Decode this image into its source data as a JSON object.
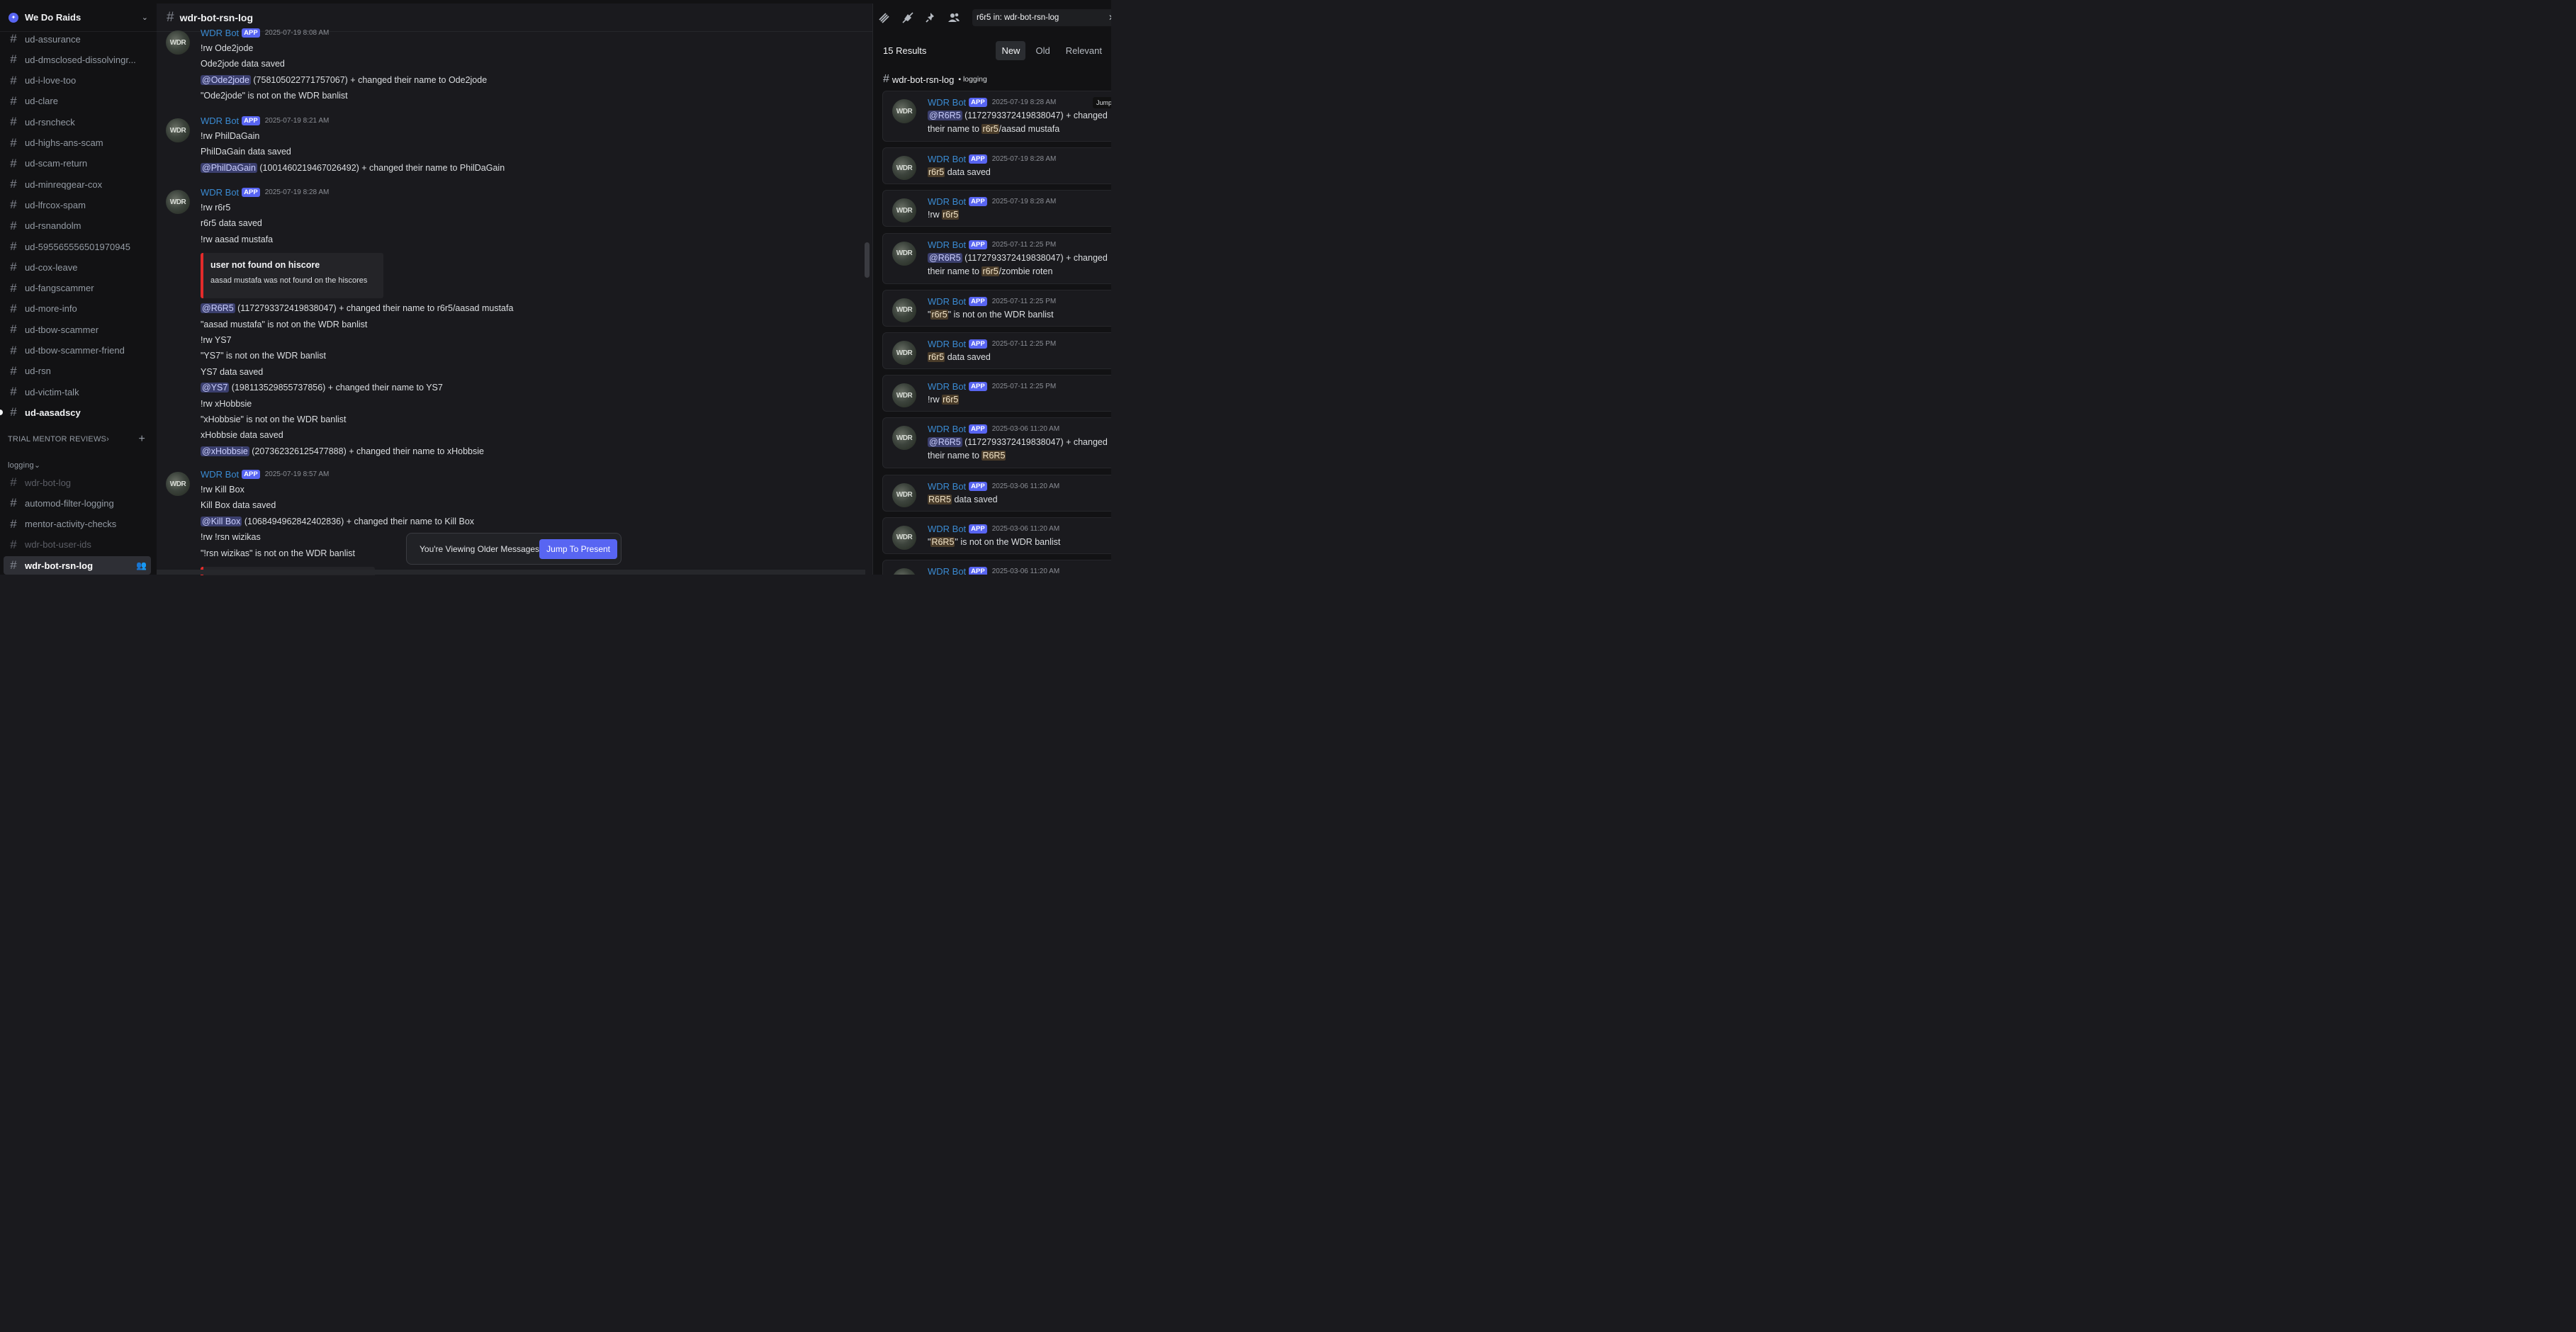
{
  "server": {
    "name": "We Do Raids"
  },
  "sidebar": {
    "channels_top": [
      {
        "name": "ud-assurance",
        "state": "normal"
      },
      {
        "name": "ud-dmsclosed-dissolvingr...",
        "state": "normal"
      },
      {
        "name": "ud-i-love-too",
        "state": "normal"
      },
      {
        "name": "ud-clare",
        "state": "normal"
      },
      {
        "name": "ud-rsncheck",
        "state": "normal"
      },
      {
        "name": "ud-highs-ans-scam",
        "state": "normal"
      },
      {
        "name": "ud-scam-return",
        "state": "normal"
      },
      {
        "name": "ud-minreqgear-cox",
        "state": "normal"
      },
      {
        "name": "ud-lfrcox-spam",
        "state": "normal"
      },
      {
        "name": "ud-rsnandolm",
        "state": "normal"
      },
      {
        "name": "ud-595565556501970945",
        "state": "normal"
      },
      {
        "name": "ud-cox-leave",
        "state": "normal"
      },
      {
        "name": "ud-fangscammer",
        "state": "normal"
      },
      {
        "name": "ud-more-info",
        "state": "normal"
      },
      {
        "name": "ud-tbow-scammer",
        "state": "normal"
      },
      {
        "name": "ud-tbow-scammer-friend",
        "state": "normal"
      },
      {
        "name": "ud-rsn",
        "state": "normal"
      },
      {
        "name": "ud-victim-talk",
        "state": "normal"
      },
      {
        "name": "ud-aasadscy",
        "state": "unread"
      }
    ],
    "category_trial": "TRIAL MENTOR REVIEWS",
    "category_logging": "logging",
    "channels_logging": [
      {
        "name": "wdr-bot-log",
        "state": "muted"
      },
      {
        "name": "automod-filter-logging",
        "state": "normal"
      },
      {
        "name": "mentor-activity-checks",
        "state": "normal"
      },
      {
        "name": "wdr-bot-user-ids",
        "state": "muted"
      },
      {
        "name": "wdr-bot-rsn-log",
        "state": "active"
      }
    ]
  },
  "channel": {
    "title": "wdr-bot-rsn-log"
  },
  "messages": [
    {
      "author": "WDR Bot",
      "badge": "APP",
      "time": "2025-07-19 8:08 AM",
      "lines": [
        {
          "text": "!rw Ode2jode"
        },
        {
          "text": "Ode2jode data saved"
        },
        {
          "mention": "@Ode2jode",
          "text": " (758105022771757067) + changed their name to Ode2jode"
        },
        {
          "text": "\"Ode2jode\" is not on the WDR banlist"
        }
      ]
    },
    {
      "author": "WDR Bot",
      "badge": "APP",
      "time": "2025-07-19 8:21 AM",
      "lines": [
        {
          "text": "!rw PhilDaGain"
        },
        {
          "text": "PhilDaGain data saved"
        },
        {
          "mention": "@PhilDaGain",
          "text": " (1001460219467026492) + changed their name to PhilDaGain"
        }
      ]
    },
    {
      "author": "WDR Bot",
      "badge": "APP",
      "time": "2025-07-19 8:28 AM",
      "lines_before": [
        {
          "text": "!rw r6r5"
        },
        {
          "text": "r6r5 data saved"
        },
        {
          "text": "!rw aasad mustafa"
        }
      ],
      "embed": {
        "title": "user not found on hiscore",
        "desc": "aasad mustafa was not found on the hiscores"
      },
      "lines_after": [
        {
          "mention": "@R6R5",
          "text": " (1172793372419838047) + changed their name to r6r5/aasad mustafa"
        },
        {
          "text": "\"aasad mustafa\" is not on the WDR banlist"
        },
        {
          "text": "!rw YS7"
        },
        {
          "text": "\"YS7\" is not on the WDR banlist"
        },
        {
          "text": "YS7 data saved"
        },
        {
          "mention": "@YS7",
          "text": " (198113529855737856) + changed their name to YS7"
        },
        {
          "text": "!rw xHobbsie"
        },
        {
          "text": "\"xHobbsie\" is not on the WDR banlist"
        },
        {
          "text": "xHobbsie data saved"
        },
        {
          "mention": "@xHobbsie",
          "text": " (207362326125477888) + changed their name to xHobbsie"
        }
      ]
    },
    {
      "author": "WDR Bot",
      "badge": "APP",
      "time": "2025-07-19 8:57 AM",
      "lines": [
        {
          "text": "!rw Kill Box"
        },
        {
          "text": "Kill Box data saved"
        },
        {
          "mention": "@Kill Box",
          "text": " (1068494962842402836) + changed their name to Kill Box"
        },
        {
          "text": "!rw !rsn wizikas"
        },
        {
          "text": "\"!rsn wizikas\" is not on the WDR banlist"
        }
      ]
    }
  ],
  "older_bar": {
    "text": "You're Viewing Older Messages",
    "button": "Jump To Present"
  },
  "search": {
    "query": "r6r5  in: wdr-bot-rsn-log",
    "count": "15 Results",
    "tabs": [
      "New",
      "Old",
      "Relevant"
    ],
    "group_channel": "wdr-bot-rsn-log",
    "group_category": "logging",
    "jump_label": "Jump",
    "results": [
      {
        "time": "2025-07-19 8:28 AM",
        "l1": [
          {
            "m": "@R6R5"
          },
          {
            "t": " (1172793372419838047) + changed"
          }
        ],
        "l2": [
          {
            "t": "their name to "
          },
          {
            "h": "r6r5"
          },
          {
            "t": "/aasad mustafa"
          }
        ]
      },
      {
        "time": "2025-07-19 8:28 AM",
        "l1": [
          {
            "h": "r6r5"
          },
          {
            "t": " data saved"
          }
        ]
      },
      {
        "time": "2025-07-19 8:28 AM",
        "l1": [
          {
            "t": "!rw "
          },
          {
            "h": "r6r5"
          }
        ]
      },
      {
        "time": "2025-07-11 2:25 PM",
        "l1": [
          {
            "m": "@R6R5"
          },
          {
            "t": " (1172793372419838047) + changed"
          }
        ],
        "l2": [
          {
            "t": "their name to "
          },
          {
            "h": "r6r5"
          },
          {
            "t": "/zombie roten"
          }
        ]
      },
      {
        "time": "2025-07-11 2:25 PM",
        "l1": [
          {
            "t": "\""
          },
          {
            "h": "r6r5"
          },
          {
            "t": "\" is not on the WDR banlist"
          }
        ]
      },
      {
        "time": "2025-07-11 2:25 PM",
        "l1": [
          {
            "h": "r6r5"
          },
          {
            "t": " data saved"
          }
        ]
      },
      {
        "time": "2025-07-11 2:25 PM",
        "l1": [
          {
            "t": "!rw "
          },
          {
            "h": "r6r5"
          }
        ]
      },
      {
        "time": "2025-03-06 11:20 AM",
        "l1": [
          {
            "m": "@R6R5"
          },
          {
            "t": " (1172793372419838047) + changed"
          }
        ],
        "l2": [
          {
            "t": "their name to "
          },
          {
            "h": "R6R5"
          }
        ]
      },
      {
        "time": "2025-03-06 11:20 AM",
        "l1": [
          {
            "h": "R6R5"
          },
          {
            "t": " data saved"
          }
        ]
      },
      {
        "time": "2025-03-06 11:20 AM",
        "l1": [
          {
            "t": "\""
          },
          {
            "h": "R6R5"
          },
          {
            "t": "\" is not on the WDR banlist"
          }
        ]
      },
      {
        "time": "2025-03-06 11:20 AM",
        "l1": []
      }
    ],
    "result_author": "WDR Bot",
    "result_badge": "APP",
    "avatar_text": "WDR"
  },
  "icons": [
    "threads-icon",
    "mute-icon",
    "pin-icon",
    "members-icon",
    "close-icon",
    "chevron-down-icon",
    "hash-icon",
    "folder-icon",
    "plus-icon",
    "add-member-icon"
  ]
}
